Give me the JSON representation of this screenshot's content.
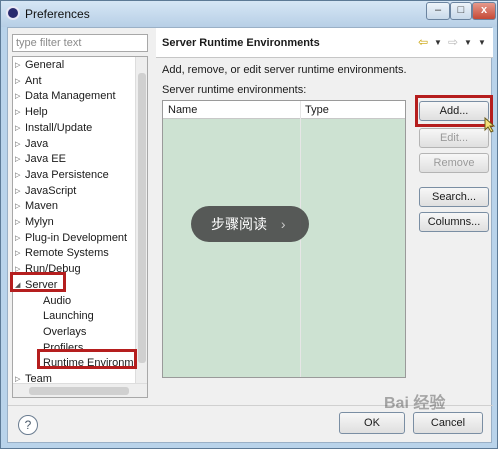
{
  "window": {
    "title": "Preferences",
    "min_label": "–",
    "max_label": "□",
    "close_label": "x"
  },
  "filter": {
    "placeholder": "type filter text"
  },
  "tree": {
    "items": [
      {
        "label": "General"
      },
      {
        "label": "Ant"
      },
      {
        "label": "Data Management"
      },
      {
        "label": "Help"
      },
      {
        "label": "Install/Update"
      },
      {
        "label": "Java"
      },
      {
        "label": "Java EE"
      },
      {
        "label": "Java Persistence"
      },
      {
        "label": "JavaScript"
      },
      {
        "label": "Maven"
      },
      {
        "label": "Mylyn"
      },
      {
        "label": "Plug-in Development"
      },
      {
        "label": "Remote Systems"
      },
      {
        "label": "Run/Debug"
      },
      {
        "label": "Server"
      }
    ],
    "children": [
      {
        "label": "Audio"
      },
      {
        "label": "Launching"
      },
      {
        "label": "Overlays"
      },
      {
        "label": "Profilers"
      },
      {
        "label": "Runtime Environm"
      }
    ],
    "after": [
      {
        "label": "Team"
      }
    ]
  },
  "page": {
    "title": "Server Runtime Environments",
    "description": "Add, remove, or edit server runtime environments.",
    "list_label": "Server runtime environments:",
    "columns": [
      "Name",
      "Type"
    ]
  },
  "buttons": {
    "add": "Add...",
    "edit": "Edit...",
    "remove": "Remove",
    "search": "Search...",
    "columns": "Columns..."
  },
  "overlay": {
    "text": "步骤阅读",
    "chevron": "›"
  },
  "footer": {
    "help": "?",
    "ok": "OK",
    "cancel": "Cancel"
  },
  "watermark": "Bai 经验",
  "colors": {
    "highlight": "#b51e1e",
    "table_bg": "#cde2d2"
  }
}
